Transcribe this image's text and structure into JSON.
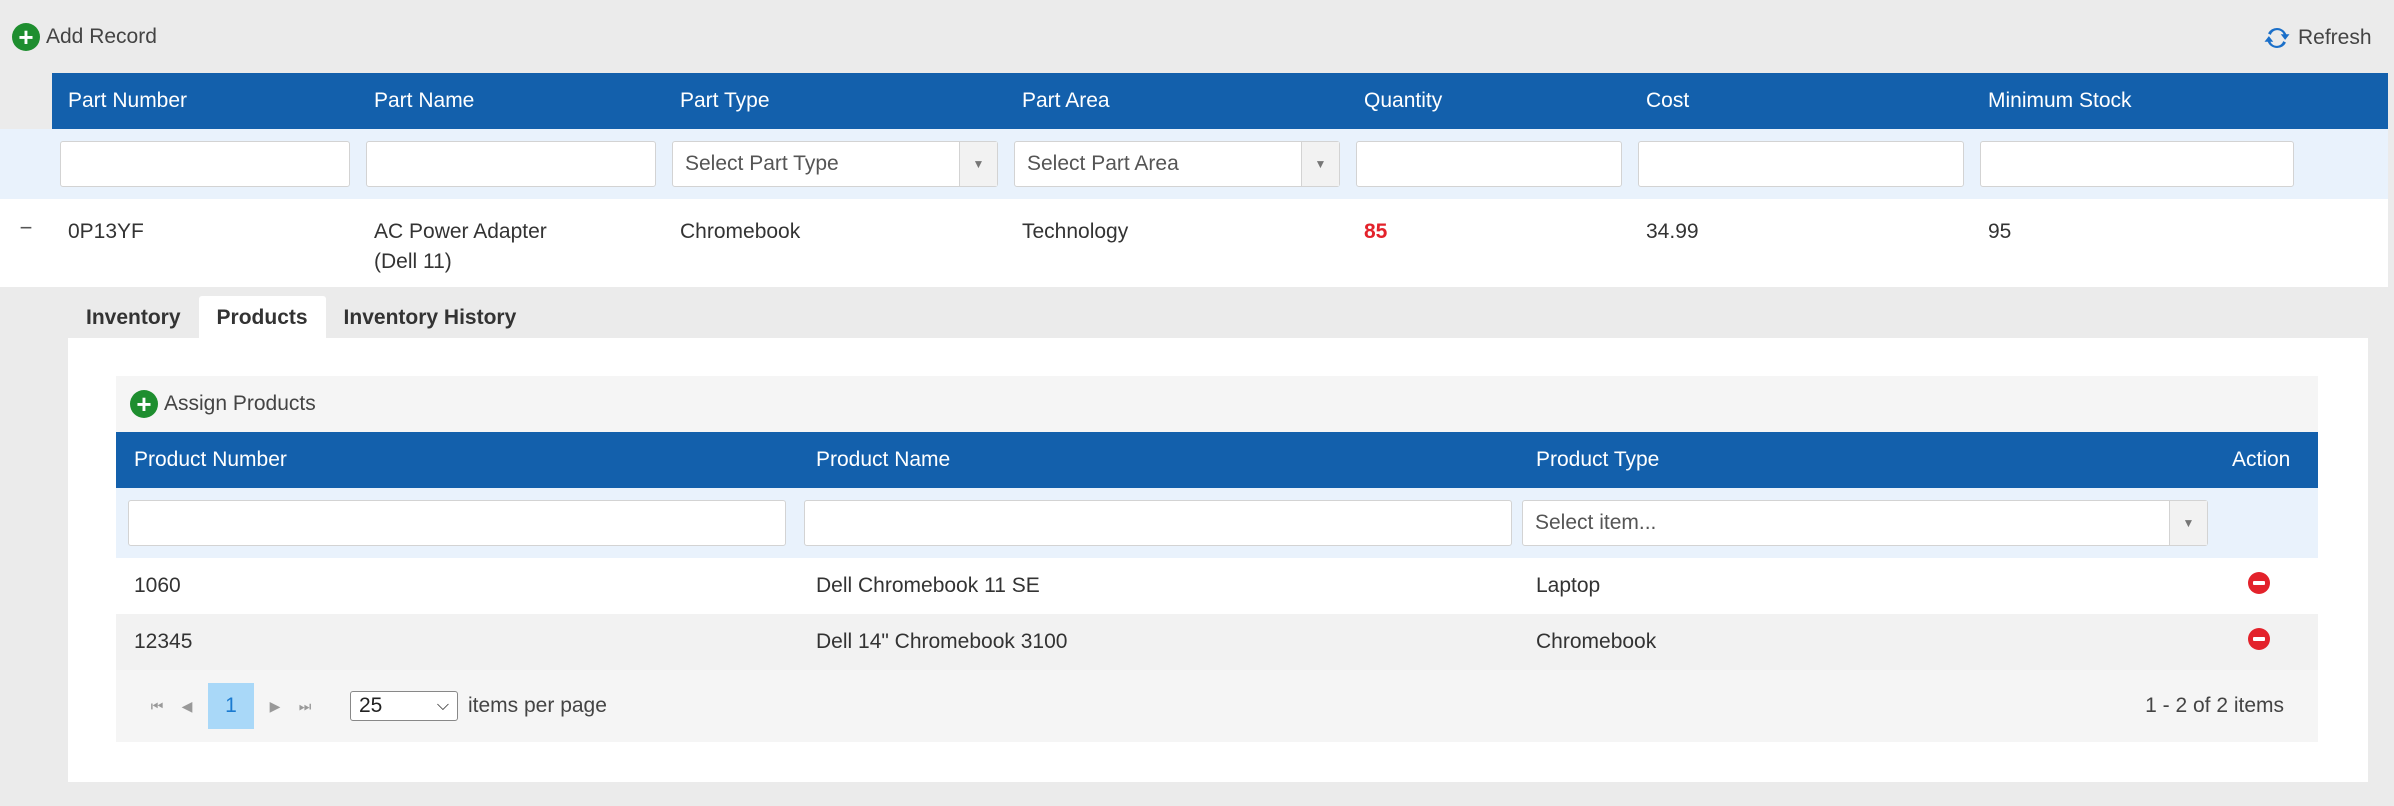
{
  "toolbar": {
    "add_label": "Add Record",
    "refresh_label": "Refresh"
  },
  "grid": {
    "columns": [
      "Part Number",
      "Part Name",
      "Part Type",
      "Part Area",
      "Quantity",
      "Cost",
      "Minimum Stock"
    ],
    "filters": {
      "part_type_placeholder": "Select Part Type",
      "part_area_placeholder": "Select Part Area"
    },
    "row": {
      "expand_glyph": "−",
      "part_number": "0P13YF",
      "part_name_line1": "AC Power Adapter",
      "part_name_line2": "(Dell 11)",
      "part_type": "Chromebook",
      "part_area": "Technology",
      "quantity": "85",
      "cost": "34.99",
      "minimum_stock": "95"
    }
  },
  "detail": {
    "tabs": [
      "Inventory",
      "Products",
      "Inventory History"
    ],
    "active_tab": "Products",
    "assign_label": "Assign Products",
    "columns": [
      "Product Number",
      "Product Name",
      "Product Type",
      "Action"
    ],
    "product_type_placeholder": "Select item...",
    "rows": [
      {
        "number": "1060",
        "name": "Dell Chromebook 11 SE",
        "type": "Laptop"
      },
      {
        "number": "12345",
        "name": "Dell 14\" Chromebook 3100",
        "type": "Chromebook"
      }
    ],
    "pager": {
      "current_page": "1",
      "page_size": "25",
      "items_label": "items per page",
      "info": "1 - 2 of 2 items"
    }
  },
  "colors": {
    "header_blue": "#1360ac",
    "add_green": "#1e8e2f",
    "alert_red": "#e3222b",
    "filter_bg": "#e9f2fc"
  }
}
